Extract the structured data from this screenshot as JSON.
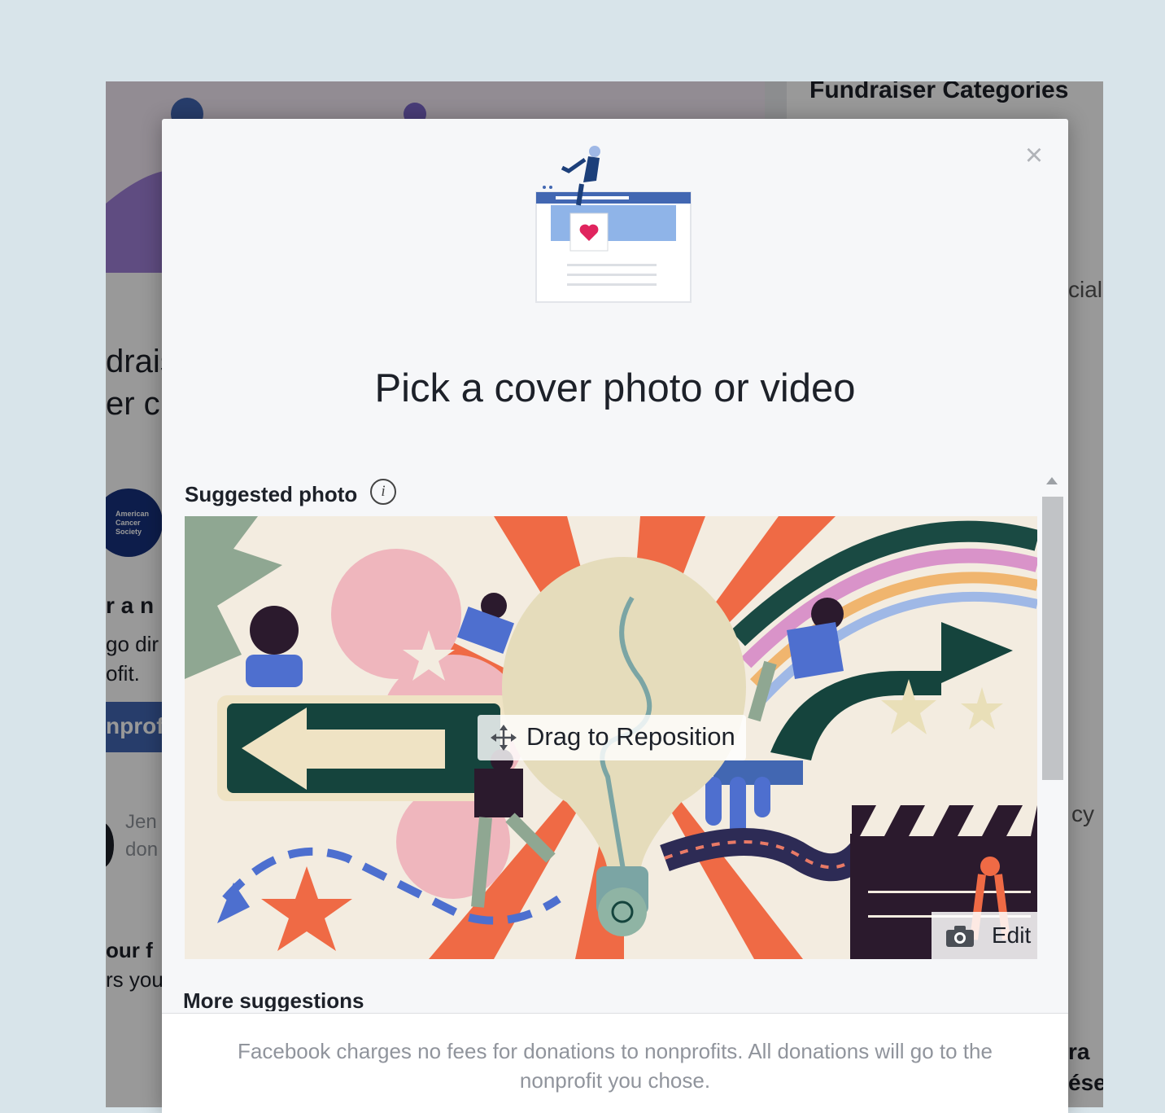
{
  "background": {
    "right_heading": "Fundraiser Categories",
    "left_lines": [
      "drais",
      "er c",
      "r a n",
      "go dir",
      "ofit.",
      "nprof",
      "Jen",
      "don",
      "our f",
      "rs you"
    ],
    "org_logo_lines": [
      "American",
      "Cancer",
      "Society"
    ],
    "right_lines": [
      "cial",
      "cy",
      "ra",
      "ése"
    ]
  },
  "modal": {
    "close_label": "×",
    "title": "Pick a cover photo or video",
    "suggested_label": "Suggested photo",
    "info_label": "i",
    "drag_label": "Drag to Reposition",
    "edit_label": "Edit",
    "more_label": "More suggestions",
    "footer_text": "Facebook charges no fees for donations to nonprofits. All donations will go to the nonprofit you chose."
  },
  "icons": [
    "close-icon",
    "info-icon",
    "move-icon",
    "camera-icon",
    "scroll-up-icon"
  ],
  "colors": {
    "accent": "#4267b2",
    "heart": "#e0245e",
    "overlay": "#000000"
  }
}
